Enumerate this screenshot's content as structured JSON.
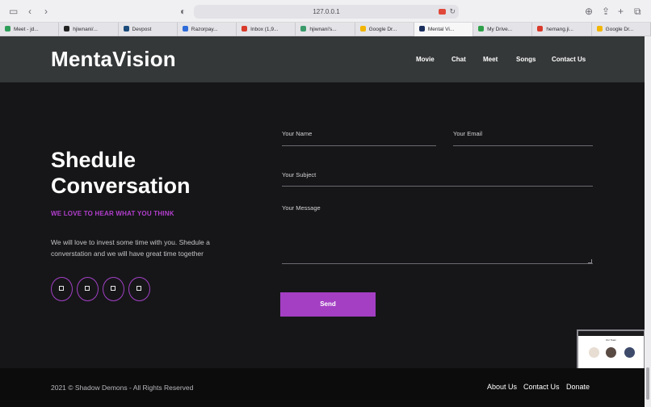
{
  "browser": {
    "url": "127.0.0.1",
    "tabs": [
      {
        "label": "Meet - jd...",
        "color": "#2f9e5a"
      },
      {
        "label": "hjiwnani/...",
        "color": "#222222"
      },
      {
        "label": "Devpost",
        "color": "#1b4b7a"
      },
      {
        "label": "Razorpay...",
        "color": "#2f6bd9"
      },
      {
        "label": "Inbox (1,9...",
        "color": "#d93a2b"
      },
      {
        "label": "hjiwnani's...",
        "color": "#3a9a6a"
      },
      {
        "label": "Google Dr...",
        "color": "#f2b500"
      },
      {
        "label": "Mental Vi...",
        "color": "#1b2f5e"
      },
      {
        "label": "My Drive...",
        "color": "#2ea04a"
      },
      {
        "label": "hemang.ji...",
        "color": "#d93a2b"
      },
      {
        "label": "Google Dr...",
        "color": "#f2b500"
      }
    ],
    "active_tab": 7
  },
  "header": {
    "logo": "MentaVision",
    "nav": [
      "Movie",
      "Chat",
      "Meet",
      "Songs",
      "Contact Us"
    ]
  },
  "hero": {
    "title": "Shedule Conversation",
    "tagline": "WE LOVE TO HEAR WHAT YOU THINK",
    "description": "We will love to invest some time with you. Shedule a converstation and we will have great time together",
    "social_icons": [
      "social-icon-1",
      "social-icon-2",
      "social-icon-3",
      "social-icon-4"
    ]
  },
  "form": {
    "name_placeholder": "Your Name",
    "email_placeholder": "Your Email",
    "subject_placeholder": "Your Subject",
    "message_placeholder": "Your Message",
    "send_label": "Send"
  },
  "preview": {
    "title": "Our Team"
  },
  "footer": {
    "copyright": "2021 © Shadow Demons - All Rights Reserved",
    "links": [
      "About Us",
      "Contact Us",
      "Donate"
    ]
  },
  "colors": {
    "accent": "#a43fc4",
    "header_bg": "#353839",
    "page_bg": "#161618",
    "footer_bg": "#0c0c0d"
  }
}
